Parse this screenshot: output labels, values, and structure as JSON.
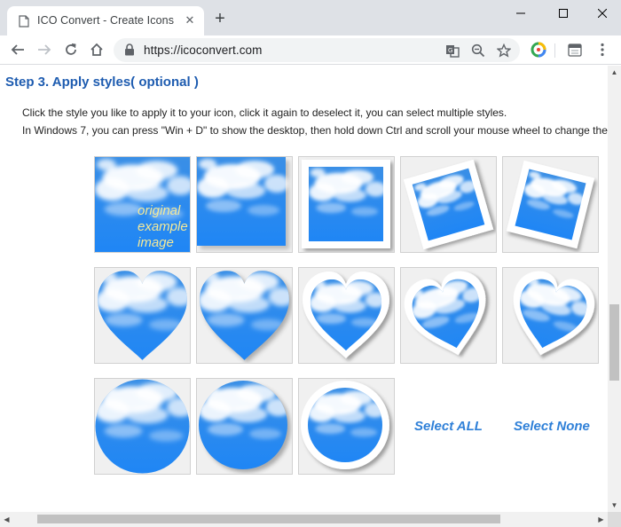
{
  "browser": {
    "tab_title": "ICO Convert - Create Icons From",
    "url": "https://icoconvert.com",
    "tab_icon": "page-icon",
    "new_tab_icon": "plus-icon",
    "close_icon": "close-icon"
  },
  "page": {
    "step_title": "Step 3. Apply styles( optional )",
    "instruction_1": "Click the style you like to apply it to your icon, click it again to deselect it, you can select multiple styles.",
    "instruction_2": "In Windows 7, you can press \"Win + D\" to show the desktop, then hold down Ctrl and scroll your mouse wheel to change the size",
    "original_label_1": "original",
    "original_label_2": "example",
    "original_label_3": "image",
    "select_all": "Select ALL",
    "select_none": "Select None",
    "styles": [
      "original",
      "square-shadow",
      "framed-square",
      "tilted-frame-left",
      "tilted-frame-right",
      "heart",
      "heart-shadow",
      "heart-framed",
      "heart-tilted-left",
      "heart-tilted-right",
      "circle",
      "circle-shadow",
      "circle-framed"
    ]
  },
  "colors": {
    "sky_blue": "#2c8bf0",
    "heading_blue": "#1e5cb0",
    "link_blue": "#2f80d8",
    "label_yellow": "#f3e99a"
  }
}
